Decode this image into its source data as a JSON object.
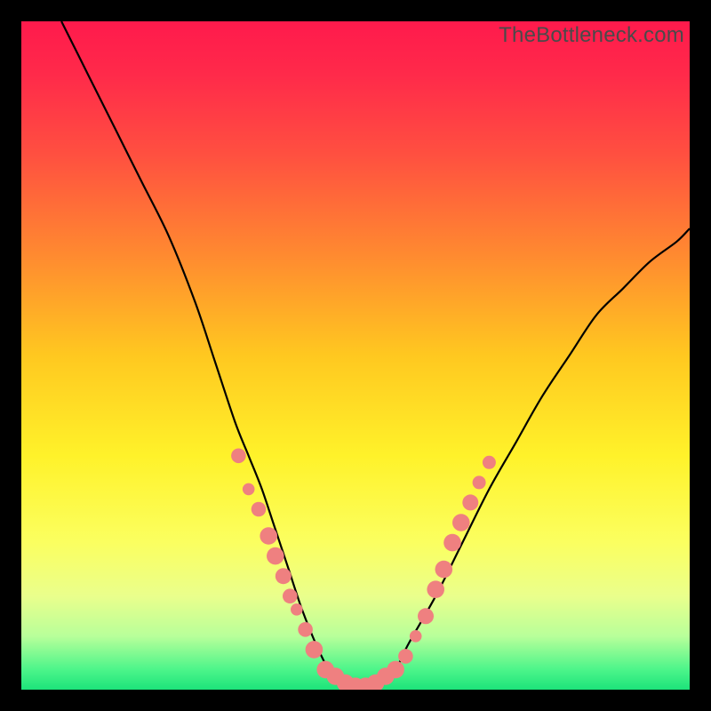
{
  "watermark": "TheBottleneck.com",
  "chart_data": {
    "type": "line",
    "title": "",
    "xlabel": "",
    "ylabel": "",
    "xlim": [
      0,
      100
    ],
    "ylim": [
      0,
      100
    ],
    "background_gradient": [
      {
        "offset": 0.0,
        "color": "#ff1a4c"
      },
      {
        "offset": 0.08,
        "color": "#ff2a4a"
      },
      {
        "offset": 0.2,
        "color": "#ff5040"
      },
      {
        "offset": 0.35,
        "color": "#ff8a30"
      },
      {
        "offset": 0.5,
        "color": "#ffc820"
      },
      {
        "offset": 0.65,
        "color": "#fff22a"
      },
      {
        "offset": 0.78,
        "color": "#fbff60"
      },
      {
        "offset": 0.86,
        "color": "#eaff8c"
      },
      {
        "offset": 0.92,
        "color": "#b8ff9a"
      },
      {
        "offset": 0.97,
        "color": "#4cf58a"
      },
      {
        "offset": 1.0,
        "color": "#1de37a"
      }
    ],
    "series": [
      {
        "name": "bottleneck-curve",
        "x": [
          6,
          10,
          14,
          18,
          22,
          26,
          29,
          32,
          34,
          36,
          38,
          40,
          42,
          44,
          46,
          48,
          50,
          52,
          54,
          56,
          58,
          62,
          66,
          70,
          74,
          78,
          82,
          86,
          90,
          94,
          98,
          100
        ],
        "y": [
          100,
          92,
          84,
          76,
          68,
          58,
          49,
          40,
          35,
          30,
          24,
          18,
          12,
          7,
          3,
          1,
          0,
          0,
          1,
          3,
          7,
          14,
          22,
          30,
          37,
          44,
          50,
          56,
          60,
          64,
          67,
          69
        ]
      }
    ],
    "markers": [
      {
        "x": 32.5,
        "y": 35,
        "r": 1.1
      },
      {
        "x": 34.0,
        "y": 30,
        "r": 0.9
      },
      {
        "x": 35.5,
        "y": 27,
        "r": 1.1
      },
      {
        "x": 37.0,
        "y": 23,
        "r": 1.3
      },
      {
        "x": 38.0,
        "y": 20,
        "r": 1.3
      },
      {
        "x": 39.2,
        "y": 17,
        "r": 1.2
      },
      {
        "x": 40.2,
        "y": 14,
        "r": 1.1
      },
      {
        "x": 41.2,
        "y": 12,
        "r": 0.9
      },
      {
        "x": 42.5,
        "y": 9,
        "r": 1.1
      },
      {
        "x": 43.8,
        "y": 6,
        "r": 1.3
      },
      {
        "x": 45.5,
        "y": 3,
        "r": 1.3
      },
      {
        "x": 47.0,
        "y": 2,
        "r": 1.3
      },
      {
        "x": 48.5,
        "y": 1,
        "r": 1.3
      },
      {
        "x": 50.0,
        "y": 0.5,
        "r": 1.3
      },
      {
        "x": 51.5,
        "y": 0.5,
        "r": 1.3
      },
      {
        "x": 53.0,
        "y": 1,
        "r": 1.3
      },
      {
        "x": 54.5,
        "y": 2,
        "r": 1.3
      },
      {
        "x": 56.0,
        "y": 3,
        "r": 1.3
      },
      {
        "x": 57.5,
        "y": 5,
        "r": 1.1
      },
      {
        "x": 59.0,
        "y": 8,
        "r": 0.9
      },
      {
        "x": 60.5,
        "y": 11,
        "r": 1.2
      },
      {
        "x": 62.0,
        "y": 15,
        "r": 1.3
      },
      {
        "x": 63.2,
        "y": 18,
        "r": 1.3
      },
      {
        "x": 64.5,
        "y": 22,
        "r": 1.3
      },
      {
        "x": 65.8,
        "y": 25,
        "r": 1.3
      },
      {
        "x": 67.2,
        "y": 28,
        "r": 1.2
      },
      {
        "x": 68.5,
        "y": 31,
        "r": 1.0
      },
      {
        "x": 70.0,
        "y": 34,
        "r": 1.0
      }
    ],
    "marker_color": "#ef8080",
    "curve_color": "#000000",
    "curve_width": 2.2
  }
}
